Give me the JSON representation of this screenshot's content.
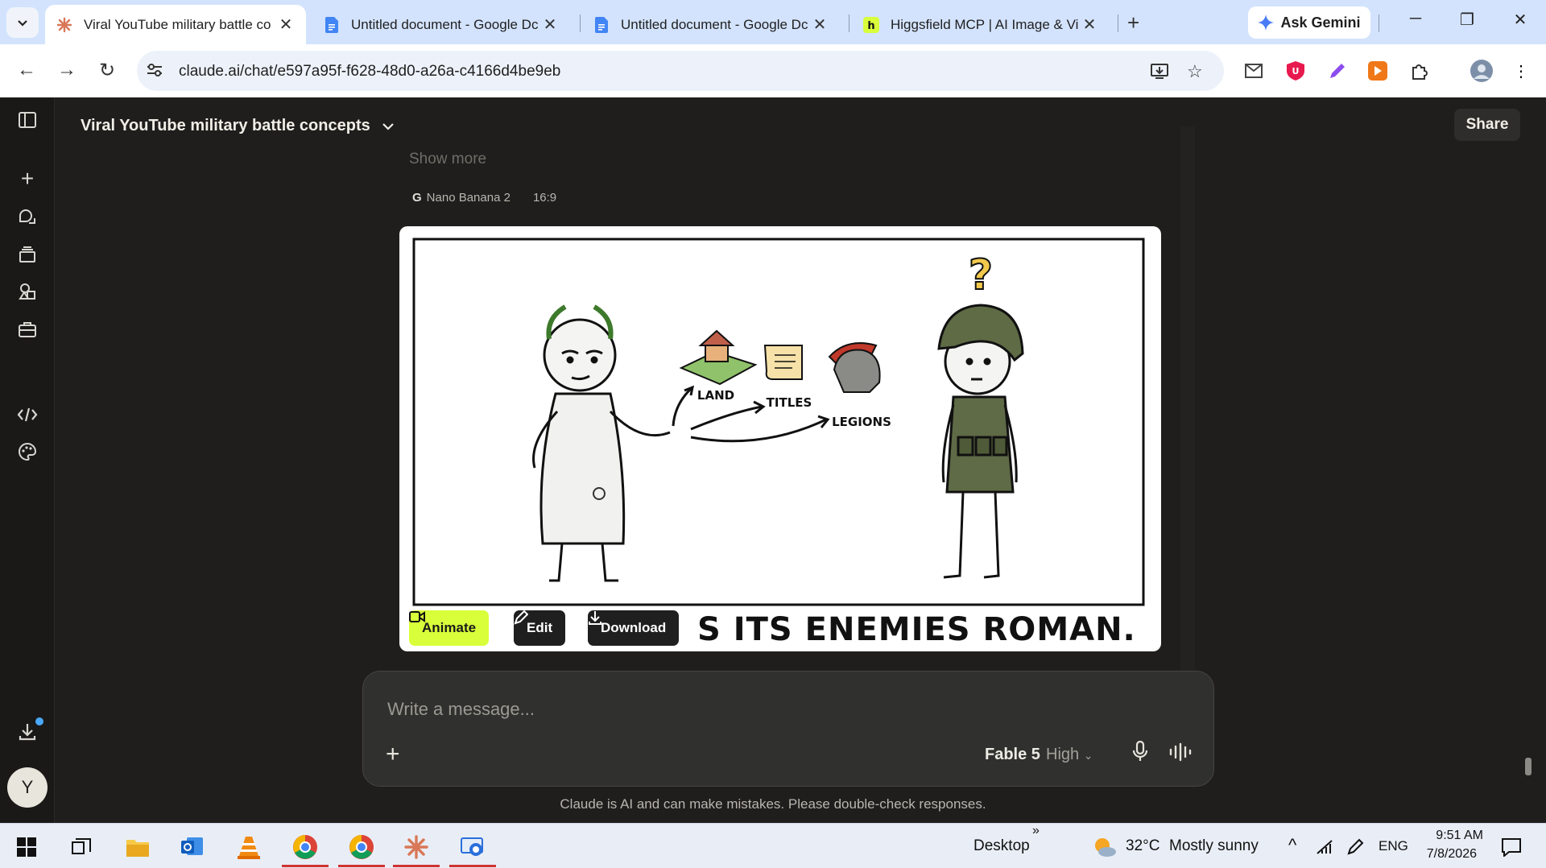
{
  "browser": {
    "tabs": [
      {
        "title": "Viral YouTube military battle co",
        "active": true
      },
      {
        "title": "Untitled document - Google Dc",
        "active": false
      },
      {
        "title": "Untitled document - Google Dc",
        "active": false
      },
      {
        "title": "Higgsfield MCP | AI Image & Vi",
        "active": false
      }
    ],
    "ask_gemini": "Ask Gemini",
    "url": "claude.ai/chat/e597a95f-f628-48d0-a26a-c4166d4be9eb"
  },
  "app": {
    "chat_title": "Viral YouTube military battle concepts",
    "share_label": "Share",
    "avatar_initial": "Y",
    "show_more": "Show more",
    "image_meta": {
      "model": "Nano Banana 2",
      "model_glyph": "G",
      "aspect": "16:9"
    },
    "image": {
      "labels": [
        "LAND",
        "TITLES",
        "LEGIONS"
      ],
      "caption": "S ITS ENEMIES ROMAN.",
      "question_mark": "?"
    },
    "image_actions": {
      "animate": "Animate",
      "edit": "Edit",
      "download": "Download"
    },
    "composer": {
      "placeholder": "Write a message...",
      "model": "Fable 5",
      "effort": "High"
    },
    "disclaimer": "Claude is AI and can make mistakes. Please double-check responses."
  },
  "taskbar": {
    "desktop_label": "Desktop",
    "chevron": "»",
    "temperature": "32°C",
    "weather": "Mostly sunny",
    "language": "ENG",
    "time": "9:51 AM",
    "date": "7/8/2026"
  },
  "colors": {
    "tabbar": "#d3e3fd",
    "app_bg": "#1f1e1d",
    "animate_accent": "#d8ff3a"
  }
}
